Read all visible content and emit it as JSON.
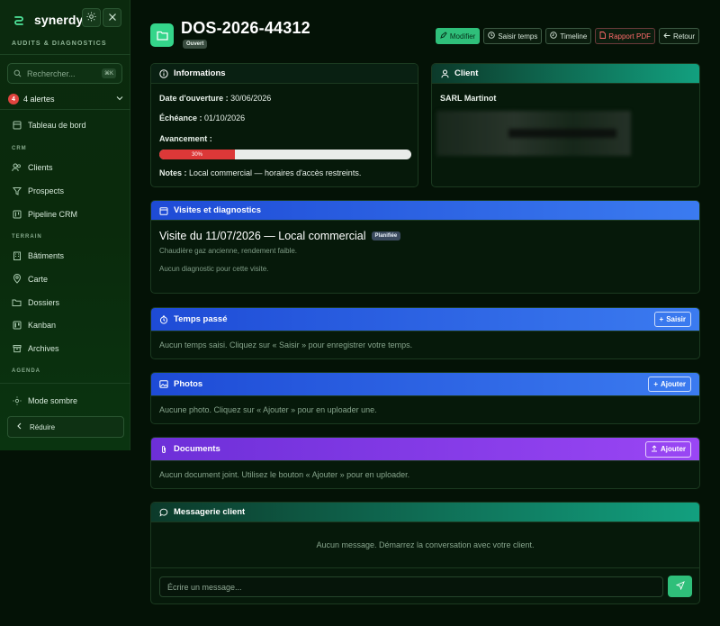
{
  "app": {
    "name": "synerdys",
    "subtitle": "AUDITS & DIAGNOSTICS"
  },
  "sidebar": {
    "search_placeholder": "Rechercher...",
    "search_shortcut": "⌘K",
    "alerts": {
      "count": "4",
      "label": "4 alertes"
    },
    "dashboard": "Tableau de bord",
    "sections": {
      "crm": "CRM",
      "terrain": "TERRAIN",
      "agenda": "AGENDA"
    },
    "crm_items": [
      "Clients",
      "Prospects",
      "Pipeline CRM"
    ],
    "terrain_items": [
      "Bâtiments",
      "Carte",
      "Dossiers",
      "Kanban",
      "Archives"
    ],
    "dark_mode": "Mode sombre",
    "collapse": "Réduire"
  },
  "header": {
    "title": "DOS-2026-44312",
    "status": "Ouvert",
    "actions": {
      "modifier": "Modifier",
      "saisir_temps": "Saisir temps",
      "timeline": "Timeline",
      "rapport_pdf": "Rapport PDF",
      "retour": "Retour"
    }
  },
  "informations": {
    "title": "Informations",
    "date_label": "Date d'ouverture :",
    "date_value": "30/06/2026",
    "echeance_label": "Échéance :",
    "echeance_value": "01/10/2026",
    "avancement_label": "Avancement :",
    "avancement_text": "30%",
    "avancement_fraction": 0.3,
    "notes_label": "Notes :",
    "notes_value": "Local commercial — horaires d'accès restreints."
  },
  "client": {
    "title": "Client",
    "name": "SARL Martinot"
  },
  "visites": {
    "title": "Visites et diagnostics",
    "visit_title": "Visite du 11/07/2026 — Local commercial",
    "visit_badge": "Planifiée",
    "visit_note": "Chaudière gaz ancienne, rendement faible.",
    "no_diag": "Aucun diagnostic pour cette visite."
  },
  "temps": {
    "title": "Temps passé",
    "button": "Saisir",
    "empty": "Aucun temps saisi. Cliquez sur « Saisir » pour enregistrer votre temps."
  },
  "photos": {
    "title": "Photos",
    "button": "Ajouter",
    "empty": "Aucune photo. Cliquez sur « Ajouter » pour en uploader une."
  },
  "documents": {
    "title": "Documents",
    "button": "Ajouter",
    "empty": "Aucun document joint. Utilisez le bouton « Ajouter » pour en uploader."
  },
  "messagerie": {
    "title": "Messagerie client",
    "empty": "Aucun message. Démarrez la conversation avec votre client.",
    "placeholder": "Écrire un message..."
  },
  "colors": {
    "accent_green": "#2fbf7a",
    "blue_header": "#2563eb",
    "purple_header": "#8b3cf0",
    "teal_header": "#19b38f",
    "progress_red": "#dc3838"
  }
}
